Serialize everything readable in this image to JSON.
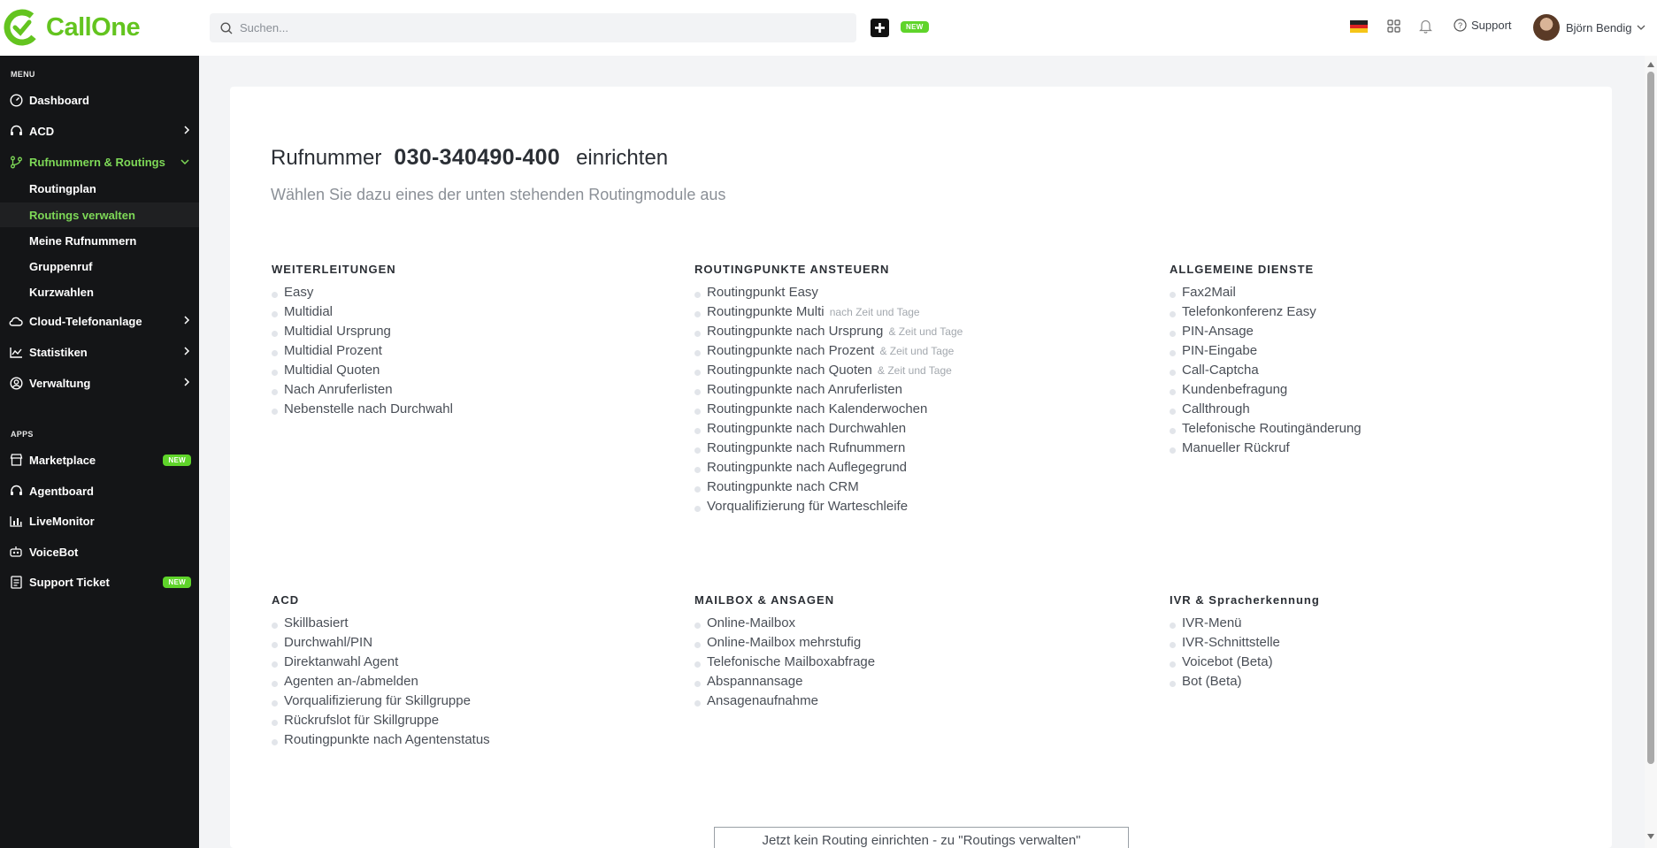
{
  "brand": {
    "name": "CallOne",
    "color": "#63c41f"
  },
  "topbar": {
    "search_placeholder": "Suchen...",
    "new_badge": "NEW",
    "support_label": "Support",
    "user_name": "Björn Bendig"
  },
  "sidebar": {
    "menu_label": "MENU",
    "apps_label": "APPS",
    "items": [
      {
        "label": "Dashboard",
        "icon": "dashboard-icon"
      },
      {
        "label": "ACD",
        "icon": "headset-icon"
      },
      {
        "label": "Rufnummern & Routings",
        "icon": "branch-icon",
        "active": true
      },
      {
        "label": "Cloud-Telefonanlage",
        "icon": "cloud-icon"
      },
      {
        "label": "Statistiken",
        "icon": "chart-icon"
      },
      {
        "label": "Verwaltung",
        "icon": "user-circle-icon"
      }
    ],
    "subitems": [
      {
        "label": "Routingplan"
      },
      {
        "label": "Routings verwalten",
        "active": true
      },
      {
        "label": "Meine Rufnummern"
      },
      {
        "label": "Gruppenruf"
      },
      {
        "label": "Kurzwahlen"
      }
    ],
    "apps": [
      {
        "label": "Marketplace",
        "icon": "store-icon",
        "badge": "NEW"
      },
      {
        "label": "Agentboard",
        "icon": "headset-icon"
      },
      {
        "label": "LiveMonitor",
        "icon": "bar-chart-icon"
      },
      {
        "label": "VoiceBot",
        "icon": "robot-icon"
      },
      {
        "label": "Support Ticket",
        "icon": "ticket-icon",
        "badge": "NEW"
      }
    ]
  },
  "main": {
    "title_prefix": "Rufnummer",
    "title_number": "030-340490-400",
    "title_suffix": "einrichten",
    "subtitle": "Wählen Sie dazu eines der unten stehenden Routingmodule aus",
    "groups": [
      {
        "heading": "WEITERLEITUNGEN",
        "items": [
          {
            "label": "Easy"
          },
          {
            "label": "Multidial"
          },
          {
            "label": "Multidial Ursprung"
          },
          {
            "label": "Multidial Prozent"
          },
          {
            "label": "Multidial Quoten"
          },
          {
            "label": "Nach Anruferlisten"
          },
          {
            "label": "Nebenstelle nach Durchwahl"
          }
        ]
      },
      {
        "heading": "ROUTINGPUNKTE ANSTEUERN",
        "items": [
          {
            "label": "Routingpunkt Easy"
          },
          {
            "label": "Routingpunkte Multi",
            "hint": "nach Zeit und Tage"
          },
          {
            "label": "Routingpunkte nach Ursprung",
            "hint": "& Zeit und Tage"
          },
          {
            "label": "Routingpunkte nach Prozent",
            "hint": "& Zeit und Tage"
          },
          {
            "label": "Routingpunkte nach Quoten",
            "hint": "& Zeit und Tage"
          },
          {
            "label": "Routingpunkte nach Anruferlisten"
          },
          {
            "label": "Routingpunkte nach Kalenderwochen"
          },
          {
            "label": "Routingpunkte nach Durchwahlen"
          },
          {
            "label": "Routingpunkte nach Rufnummern"
          },
          {
            "label": "Routingpunkte nach Auflegegrund"
          },
          {
            "label": "Routingpunkte nach CRM"
          },
          {
            "label": "Vorqualifizierung für Warteschleife"
          }
        ]
      },
      {
        "heading": "ALLGEMEINE DIENSTE",
        "items": [
          {
            "label": "Fax2Mail"
          },
          {
            "label": "Telefonkonferenz Easy"
          },
          {
            "label": "PIN-Ansage"
          },
          {
            "label": "PIN-Eingabe"
          },
          {
            "label": "Call-Captcha"
          },
          {
            "label": "Kundenbefragung"
          },
          {
            "label": "Callthrough"
          },
          {
            "label": "Telefonische Routingänderung"
          },
          {
            "label": "Manueller Rückruf"
          }
        ]
      },
      {
        "heading": "ACD",
        "items": [
          {
            "label": "Skillbasiert"
          },
          {
            "label": "Durchwahl/PIN"
          },
          {
            "label": "Direktanwahl Agent"
          },
          {
            "label": "Agenten an-/abmelden"
          },
          {
            "label": "Vorqualifizierung für Skillgruppe"
          },
          {
            "label": "Rückrufslot für Skillgruppe"
          },
          {
            "label": "Routingpunkte nach Agentenstatus"
          }
        ]
      },
      {
        "heading": "MAILBOX & ANSAGEN",
        "items": [
          {
            "label": "Online-Mailbox"
          },
          {
            "label": "Online-Mailbox mehrstufig"
          },
          {
            "label": "Telefonische Mailboxabfrage"
          },
          {
            "label": "Abspannansage"
          },
          {
            "label": "Ansagenaufnahme"
          }
        ]
      },
      {
        "heading": "IVR & Spracherkennung",
        "items": [
          {
            "label": "IVR-Menü"
          },
          {
            "label": "IVR-Schnittstelle"
          },
          {
            "label": "Voicebot (Beta)"
          },
          {
            "label": "Bot (Beta)"
          }
        ]
      }
    ],
    "footer_button": "Jetzt kein Routing einrichten - zu \"Routings verwalten\""
  }
}
